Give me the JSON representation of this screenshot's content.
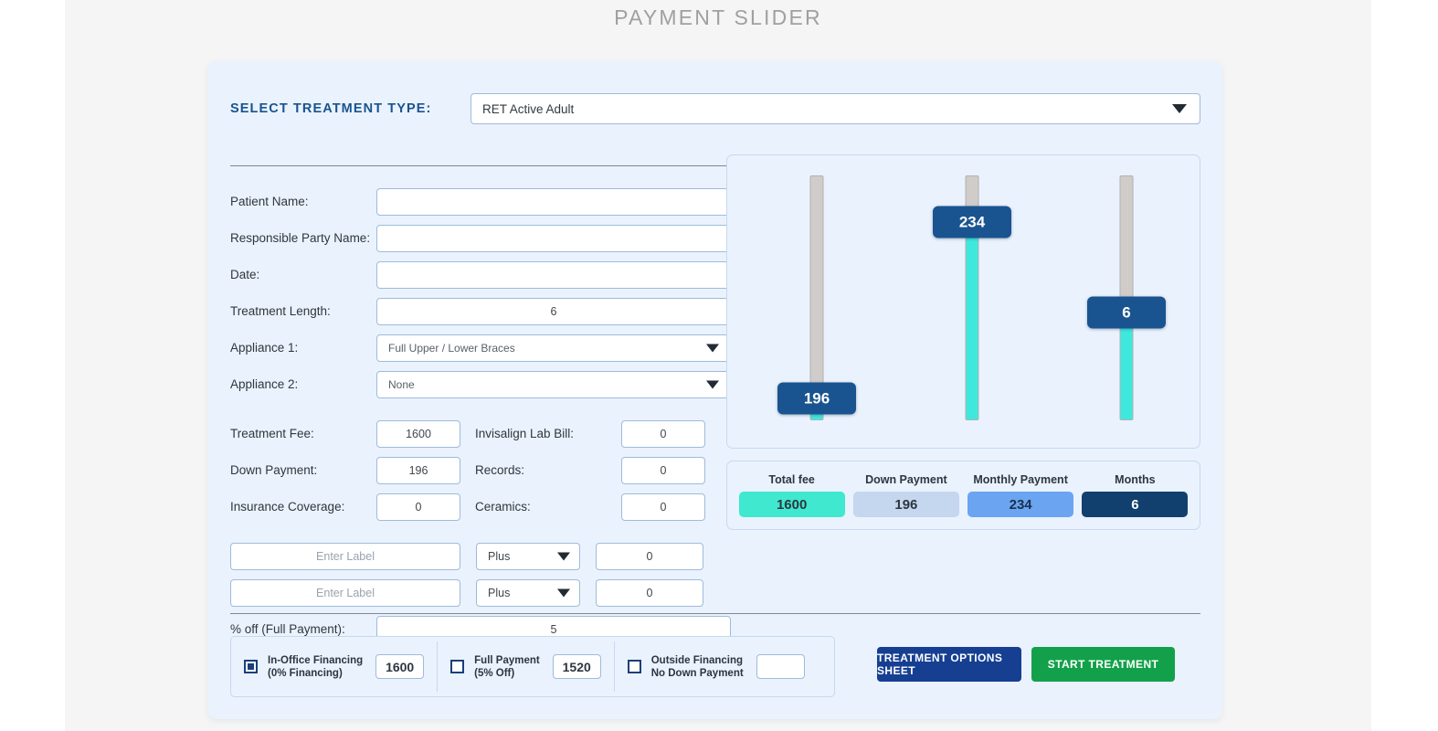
{
  "page": {
    "title": "PAYMENT SLIDER"
  },
  "treatment": {
    "label": "SELECT TREATMENT TYPE:",
    "selected": "RET Active Adult"
  },
  "form": {
    "fields": [
      {
        "label": "Patient Name:",
        "value": "",
        "type": "text"
      },
      {
        "label": "Responsible Party Name:",
        "value": "",
        "type": "text"
      },
      {
        "label": "Date:",
        "value": "",
        "type": "text"
      },
      {
        "label": "Treatment Length:",
        "value": "6",
        "type": "text"
      },
      {
        "label": "Appliance 1:",
        "value": "Full Upper / Lower Braces",
        "type": "select"
      },
      {
        "label": "Appliance 2:",
        "value": "None",
        "type": "select"
      }
    ],
    "money": [
      {
        "label": "Treatment Fee:",
        "value": "1600",
        "label2": "Invisalign Lab Bill:",
        "value2": "0"
      },
      {
        "label": "Down Payment:",
        "value": "196",
        "label2": "Records:",
        "value2": "0"
      },
      {
        "label": "Insurance Coverage:",
        "value": "0",
        "label2": "Ceramics:",
        "value2": "0"
      }
    ],
    "custom": [
      {
        "placeholder": "Enter Label",
        "op": "Plus",
        "value": "0"
      },
      {
        "placeholder": "Enter Label",
        "op": "Plus",
        "value": "0"
      }
    ],
    "percent_off": {
      "label": "% off (Full Payment):",
      "value": "5"
    }
  },
  "sliders": [
    {
      "name": "down-payment",
      "value": "196",
      "fill_pct": 9,
      "lock": "unlocked"
    },
    {
      "name": "monthly-payment",
      "value": "234",
      "fill_pct": 81,
      "lock": "unlocked"
    },
    {
      "name": "months",
      "value": "6",
      "fill_pct": 44,
      "lock": "unlocked"
    }
  ],
  "summary": [
    {
      "title": "Total fee",
      "value": "1600",
      "bg": "#3fe8cf",
      "fg": "#2d3640"
    },
    {
      "title": "Down Payment",
      "value": "196",
      "bg": "#c5d6ef",
      "fg": "#2d3640"
    },
    {
      "title": "Monthly Payment",
      "value": "234",
      "bg": "#6ba4f0",
      "fg": "#17314f"
    },
    {
      "title": "Months",
      "value": "6",
      "bg": "#11406f",
      "fg": "#ffffff"
    }
  ],
  "payment_options": [
    {
      "line1": "In-Office Financing",
      "line2": "(0% Financing)",
      "value": "1600",
      "checked": true
    },
    {
      "line1": "Full Payment",
      "line2": "(5% Off)",
      "value": "1520",
      "checked": false
    },
    {
      "line1": "Outside Financing",
      "line2": "No Down Payment",
      "value": "",
      "checked": false
    }
  ],
  "actions": {
    "options_sheet": "TREATMENT OPTIONS SHEET",
    "start_treatment": "START TREATMENT"
  },
  "colors": {
    "accent_navy": "#1a5490",
    "accent_cyan": "#3fe8dd",
    "btn_blue": "#163f92",
    "btn_green": "#12a14a",
    "card_bg": "#eaf2fd"
  }
}
